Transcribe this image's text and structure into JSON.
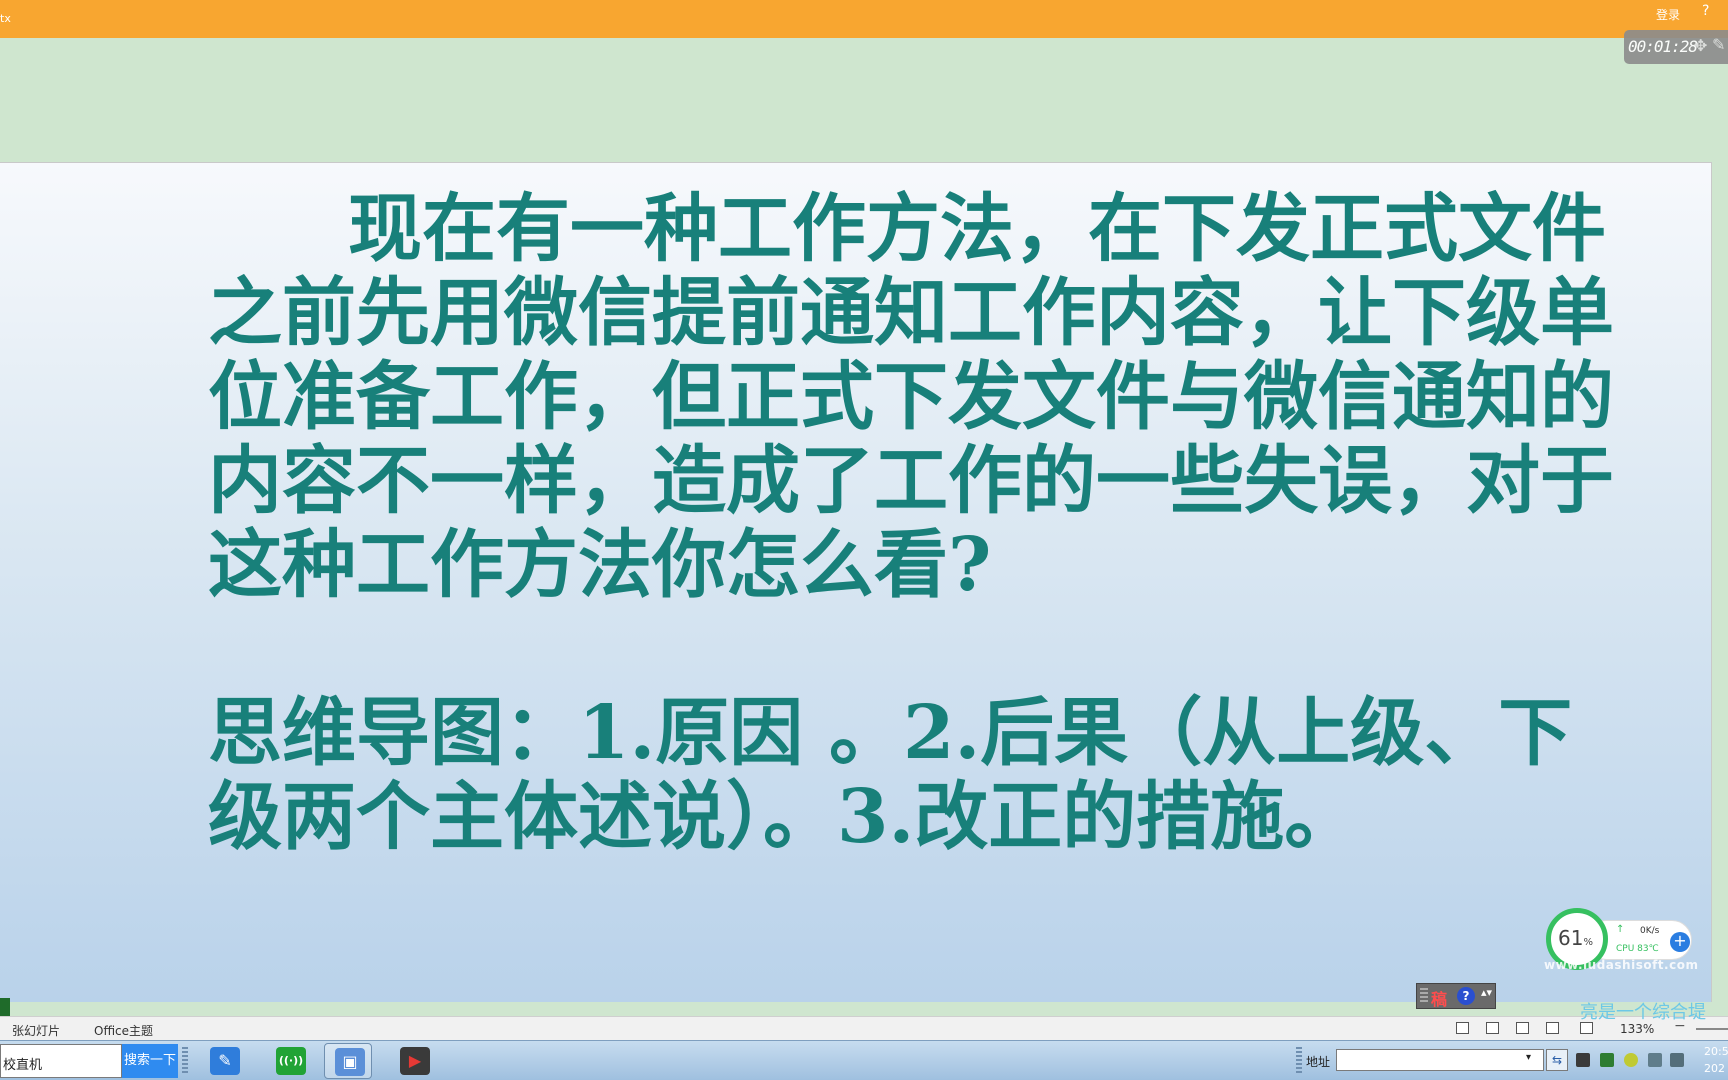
{
  "topbar": {
    "left_fragment": "tx",
    "login_label": "登录",
    "help_label": "?"
  },
  "recorder": {
    "time": "00:01:28",
    "icons": [
      "move-icon",
      "pen-icon"
    ]
  },
  "slide": {
    "paragraph1": "现在有一种工作方法，在下发正式文件之前先用微信提前通知工作内容，让下级单位准备工作，但正式下发文件与微信通知的内容不一样，造成了工作的一些失误，对于这种工作方法你怎么看?",
    "paragraph2": "思维导图：1.原因 。2.后果（从上级、下级两个主体述说）。3.改正的措施。"
  },
  "ime_toolbar": {
    "char": "稿",
    "help": "?",
    "arrow": "▴▾"
  },
  "net_widget": {
    "percent": "61",
    "percent_unit": "%",
    "speed": "0K/s",
    "cpu": "CPU 83℃",
    "up_arrow": "↑",
    "plus": "+",
    "watermark": "www.ludashisoft.com"
  },
  "statusbar": {
    "slides_label": "张幻灯片",
    "theme_label": "Office主题",
    "zoom": "133%",
    "zoom_minus": "−",
    "view_icons": [
      "normal-view-icon",
      "slide-sorter-icon",
      "reading-view-icon",
      "slideshow-icon",
      "notes-icon"
    ]
  },
  "overlay_text": "亮是一个综合堤",
  "taskbar": {
    "search_value": "校直机",
    "search_button": "搜索一下",
    "apps": [
      {
        "name": "pen-app-icon",
        "glyph": "✎",
        "color": "#2f7ddb"
      },
      {
        "name": "wifi-app-icon",
        "glyph": "((·))",
        "color": "#21a336"
      },
      {
        "name": "screen-recorder-app-icon",
        "glyph": "▣",
        "color": "#5b8fd8"
      },
      {
        "name": "video-player-app-icon",
        "glyph": "▶",
        "color": "#c62828"
      }
    ],
    "address_label": "地址",
    "address_value": "",
    "address_dropdown": "▾",
    "address_go": "⇆",
    "clock_time": "20:5",
    "clock_date": "202"
  }
}
